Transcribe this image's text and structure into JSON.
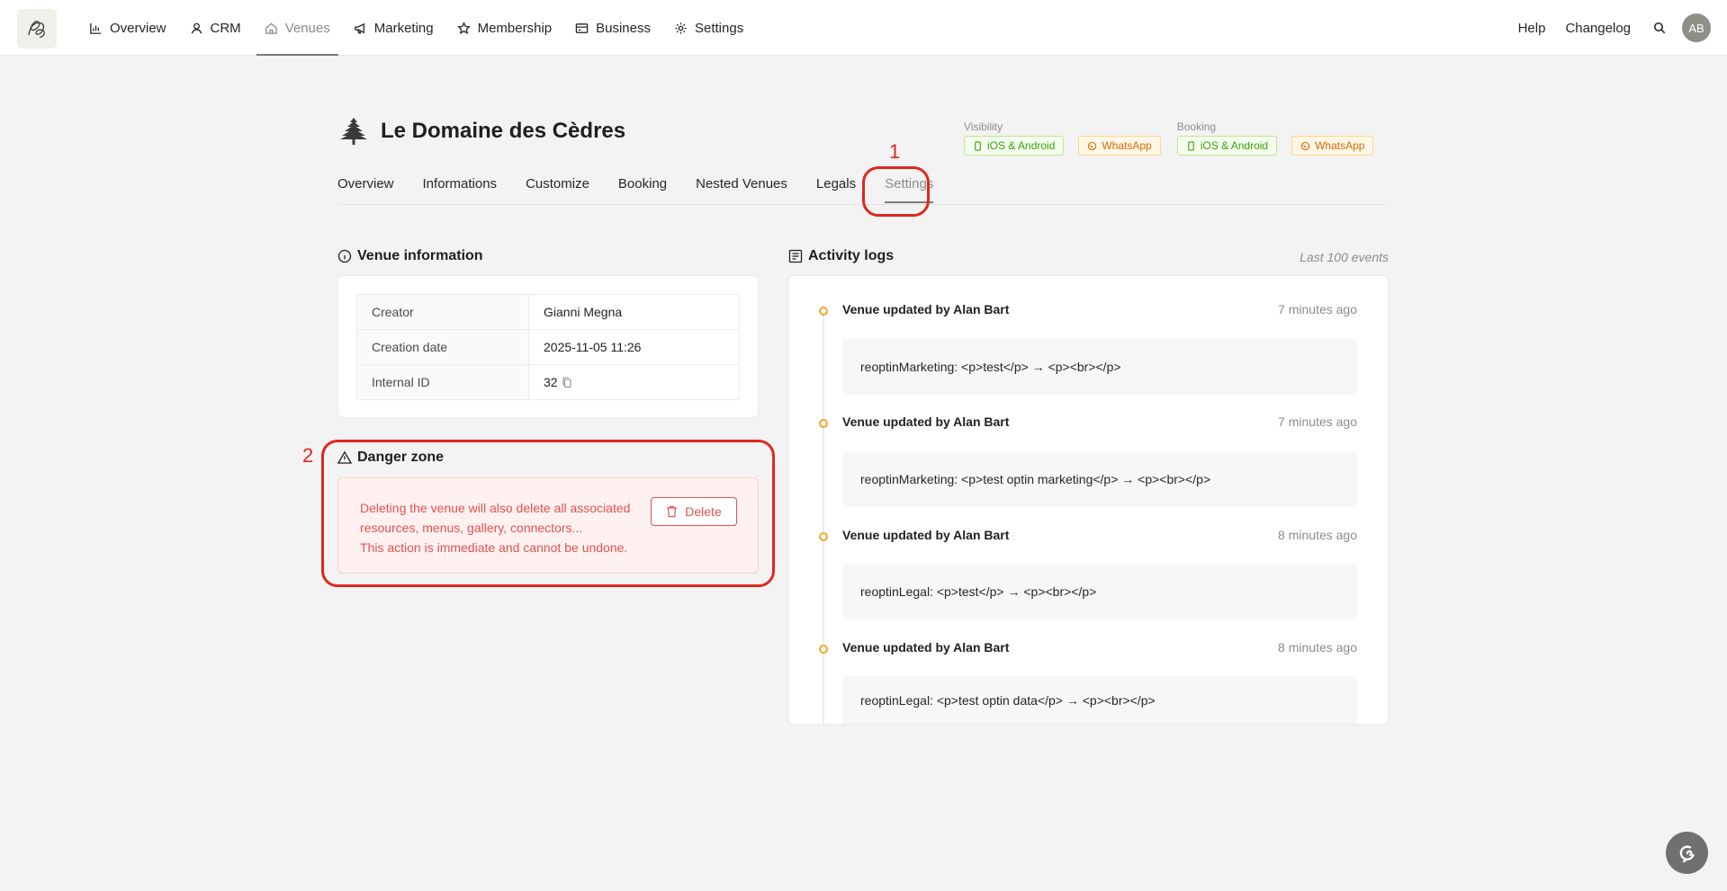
{
  "nav": {
    "items": [
      {
        "label": "Overview",
        "icon": "chart-icon"
      },
      {
        "label": "CRM",
        "icon": "user-icon"
      },
      {
        "label": "Venues",
        "icon": "home-icon",
        "active": true
      },
      {
        "label": "Marketing",
        "icon": "megaphone-icon"
      },
      {
        "label": "Membership",
        "icon": "star-icon"
      },
      {
        "label": "Business",
        "icon": "wallet-icon"
      },
      {
        "label": "Settings",
        "icon": "gear-icon"
      }
    ],
    "help": "Help",
    "changelog": "Changelog",
    "avatar_initials": "AB"
  },
  "venue": {
    "title": "Le Domaine des Cèdres",
    "visibility_label": "Visibility",
    "booking_label": "Booking",
    "chips": {
      "ios": "iOS & Android",
      "whatsapp": "WhatsApp"
    },
    "tabs": [
      "Overview",
      "Informations",
      "Customize",
      "Booking",
      "Nested Venues",
      "Legals",
      "Settings"
    ],
    "active_tab": "Settings"
  },
  "annotations": {
    "one": "1",
    "two": "2"
  },
  "venue_information": {
    "title": "Venue information",
    "rows": [
      {
        "key": "Creator",
        "value": "Gianni Megna"
      },
      {
        "key": "Creation date",
        "value": "2025-11-05 11:26"
      },
      {
        "key": "Internal ID",
        "value": "32"
      }
    ]
  },
  "danger_zone": {
    "title": "Danger zone",
    "line1": "Deleting the venue will also delete all associated resources, menus, gallery, connectors...",
    "line2": "This action is immediate and cannot be undone.",
    "delete_label": "Delete"
  },
  "activity_logs": {
    "title": "Activity logs",
    "subtitle": "Last 100 events",
    "entries": [
      {
        "title": "Venue updated by Alan Bart",
        "time": "7 minutes ago",
        "change": "reoptinMarketing: <p>test</p> → <p><br></p>"
      },
      {
        "title": "Venue updated by Alan Bart",
        "time": "7 minutes ago",
        "change": "reoptinMarketing: <p>test optin marketing</p> → <p><br></p>"
      },
      {
        "title": "Venue updated by Alan Bart",
        "time": "8 minutes ago",
        "change": "reoptinLegal: <p>test</p> → <p><br></p>"
      },
      {
        "title": "Venue updated by Alan Bart",
        "time": "8 minutes ago",
        "change": "reoptinLegal: <p>test optin data</p> → <p><br></p>"
      }
    ]
  },
  "colors": {
    "accent_red": "#e0281d",
    "danger_text": "#e05252",
    "timeline_dot": "#f5a623"
  }
}
